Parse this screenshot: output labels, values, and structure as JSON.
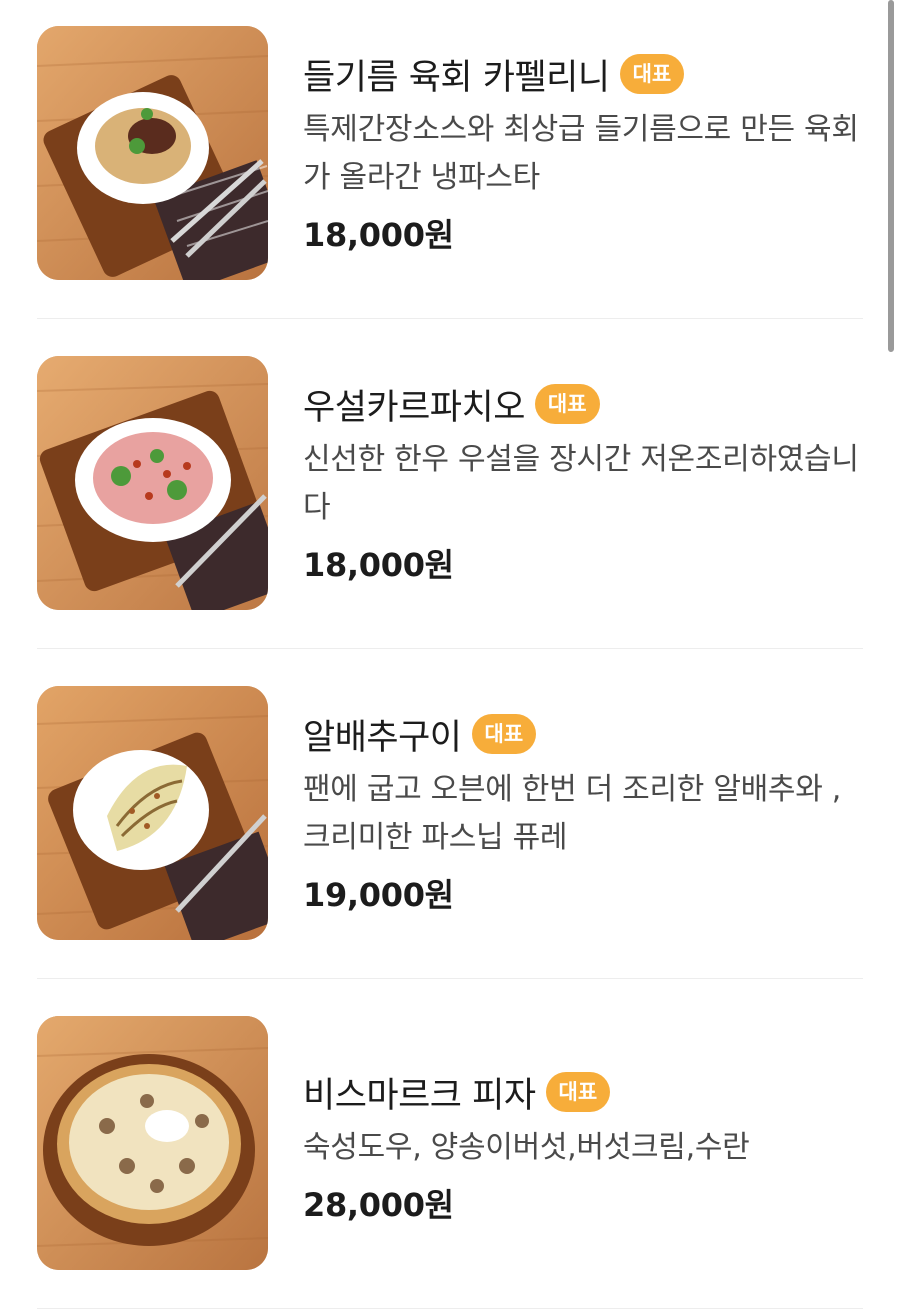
{
  "menu": {
    "items": [
      {
        "name": "들기름 육회 카펠리니",
        "badge": "대표",
        "description": "특제간장소스와 최상급 들기름으로 만든 육회가 올라간 냉파스타",
        "price": "18,000원",
        "icon": "pasta-dish-image"
      },
      {
        "name": "우설카르파치오",
        "badge": "대표",
        "description": "신선한 한우 우설을 장시간 저온조리하였습니다",
        "price": "18,000원",
        "icon": "carpaccio-dish-image"
      },
      {
        "name": "알배추구이",
        "badge": "대표",
        "description": "팬에 굽고 오븐에 한번 더 조리한 알배추와 , 크리미한 파스닙 퓨레",
        "price": "19,000원",
        "icon": "cabbage-dish-image"
      },
      {
        "name": "비스마르크 피자",
        "badge": "대표",
        "description": "숙성도우, 양송이버섯,버섯크림,수란",
        "price": "28,000원",
        "icon": "pizza-dish-image"
      }
    ]
  },
  "colors": {
    "badge": "#f7ad3a",
    "wood": "#c98a4f",
    "divider": "#ededed"
  }
}
